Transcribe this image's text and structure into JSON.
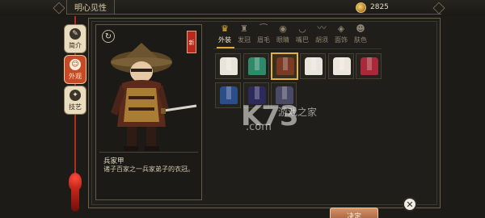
{
  "header": {
    "title": "明心见性",
    "currency_amount": "2825"
  },
  "sidebar": {
    "items": [
      {
        "label": "简介",
        "icon": "scroll-icon"
      },
      {
        "label": "外观",
        "icon": "portrait-icon"
      },
      {
        "label": "技艺",
        "icon": "skill-icon"
      }
    ]
  },
  "character": {
    "badge": "新",
    "name": "兵家甲",
    "description": "诸子百家之一兵家弟子的衣冠。",
    "rotate_icon": "rotate-icon"
  },
  "tabs": [
    "外装",
    "发冠",
    "眉毛",
    "眼睛",
    "嘴巴",
    "胡须",
    "面饰",
    "肤色"
  ],
  "active_tab": 0,
  "outfits": [
    {
      "color": "#e8e4da"
    },
    {
      "color": "#2f8a6c"
    },
    {
      "color": "#7a3a24",
      "selected": true
    },
    {
      "color": "#e9e5dd"
    },
    {
      "color": "#ece6dc"
    },
    {
      "color": "#a8293a"
    },
    {
      "color": "#2c4c8a"
    },
    {
      "color": "#2c2a5a"
    },
    {
      "color": "#4a4a66"
    }
  ],
  "colors": {
    "accent": "#e6a83a",
    "thread": "#b32a1e",
    "button": "#9c5531"
  },
  "actions": {
    "decide": "决定"
  },
  "watermark": {
    "brand": "K73",
    "site": ".com",
    "cn": "游戏之家"
  }
}
